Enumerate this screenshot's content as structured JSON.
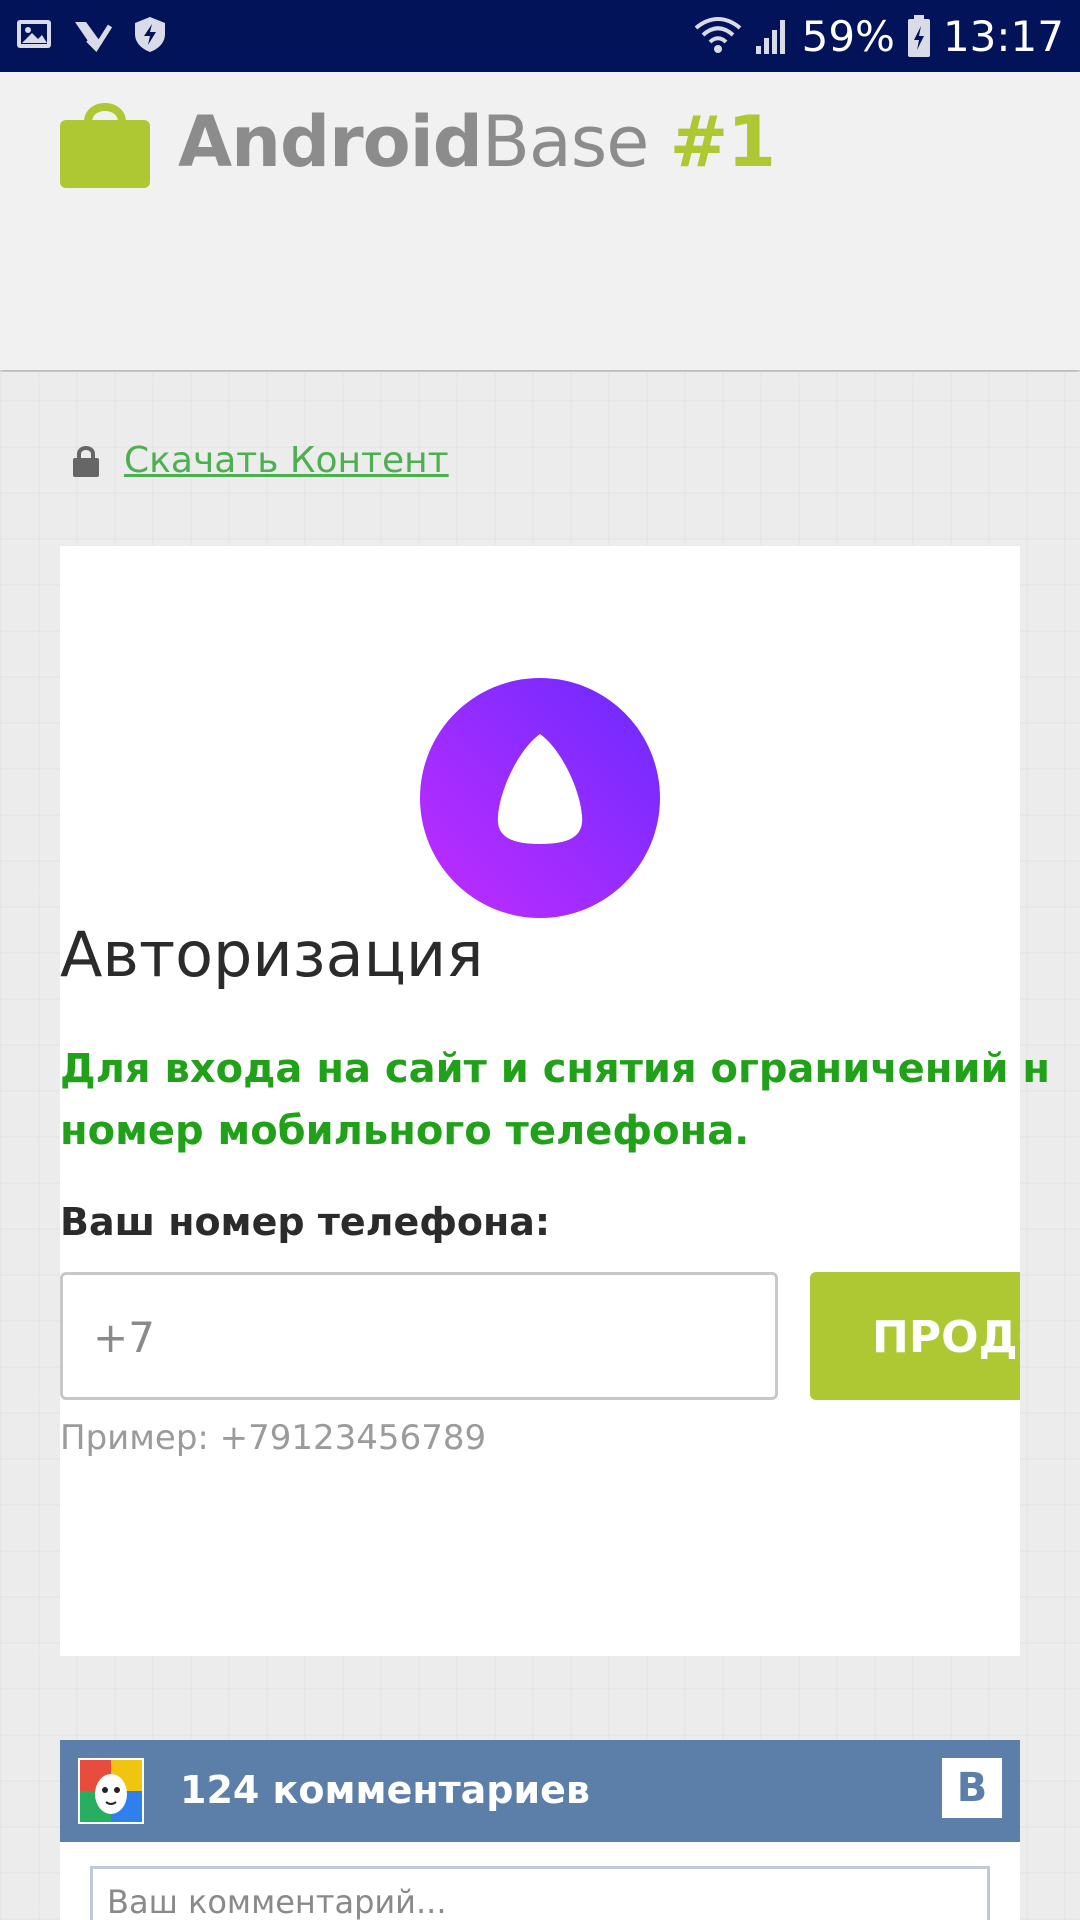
{
  "status_bar": {
    "battery": "59%",
    "time": "13:17",
    "icons": [
      "gallery-icon",
      "check-icon",
      "shield-icon",
      "wifi-icon",
      "signal-icon",
      "battery-icon"
    ]
  },
  "header": {
    "logo_part1": "Android",
    "logo_part2": "Base",
    "logo_part3": "#1",
    "logo_colors": {
      "grey": "#8c8c8c",
      "green": "#aec834"
    }
  },
  "download_link": "Скачать Контент",
  "auth": {
    "title": "Авторизация",
    "description": "Для входа на сайт и снятия ограничений н\nномер мобильного телефона.",
    "phone_label": "Ваш номер телефона:",
    "phone_value": "+7",
    "continue_label": "ПРОДОЛЖ",
    "example": "Пример: +79123456789"
  },
  "comments": {
    "count_label": "124 комментариев",
    "vk_label": "B",
    "placeholder": "Ваш комментарий..."
  }
}
